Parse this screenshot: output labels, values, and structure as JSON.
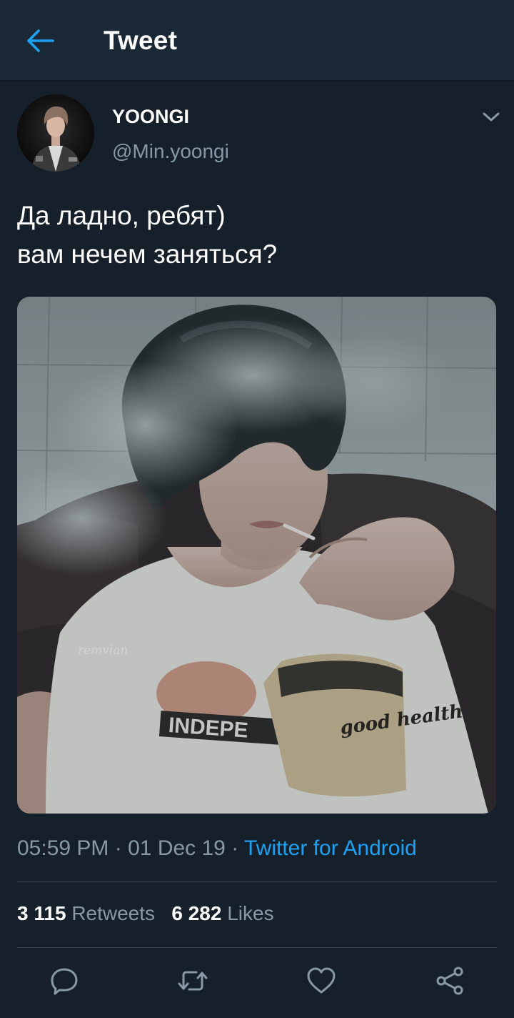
{
  "header": {
    "title": "Tweet",
    "back_icon": "arrow-left-icon"
  },
  "tweet": {
    "author": {
      "display_name": "YOONGI",
      "handle": "@Min.yoongi"
    },
    "menu_icon": "chevron-down-icon",
    "text_lines": [
      "Да ладно, ребят)",
      "вам нечем заняться?"
    ],
    "photo_watermark": "remvian",
    "photo_shirt_text": "INDEPE",
    "photo_bag_text": "good health",
    "time": "05:59 PM",
    "separator": "·",
    "date": "01 Dec 19",
    "source": "Twitter for Android",
    "retweets_count": "3 115",
    "retweets_label": "Retweets",
    "likes_count": "6 282",
    "likes_label": "Likes"
  },
  "actions": {
    "reply_icon": "reply-icon",
    "retweet_icon": "retweet-icon",
    "like_icon": "heart-icon",
    "share_icon": "share-icon"
  },
  "colors": {
    "background": "#15202b",
    "header_bg": "#1b2836",
    "accent": "#1da1f2",
    "secondary_text": "#8899a6",
    "divider": "#38444d"
  }
}
